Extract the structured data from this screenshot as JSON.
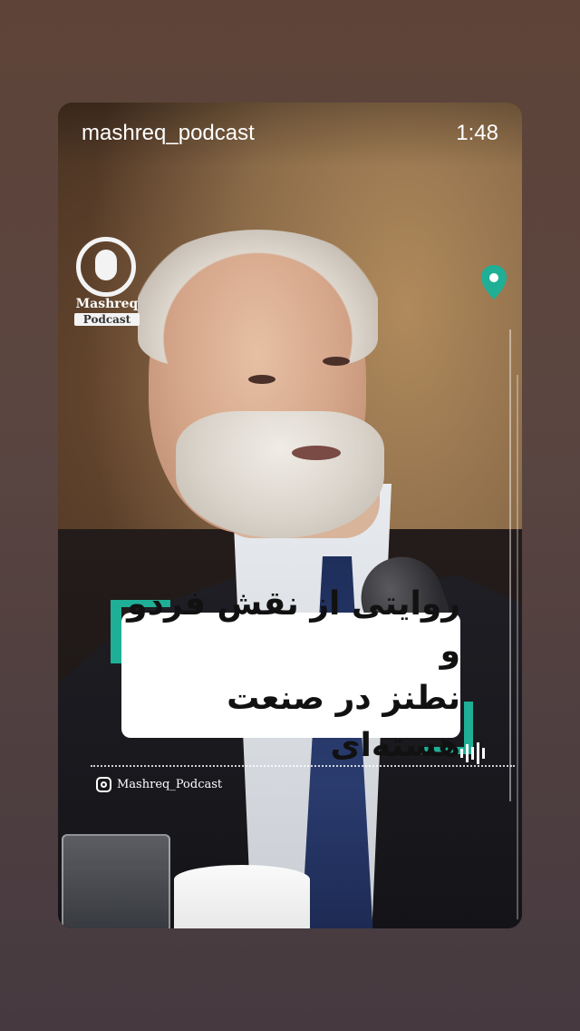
{
  "story": {
    "username": "mashreq_podcast",
    "duration": "1:48"
  },
  "logo": {
    "word1": "Mashreq",
    "word2": "Podcast",
    "icon": "microphone-icon"
  },
  "caption": {
    "line1": "روایتی از نقش فردو و",
    "line2": "نطنز در صنعت هسته‌ای"
  },
  "footer": {
    "handle": "Mashreq_Podcast",
    "icon": "instagram-icon"
  },
  "colors": {
    "accent": "#1faf96",
    "pin": "#1faf96",
    "text": "#ffffff"
  }
}
